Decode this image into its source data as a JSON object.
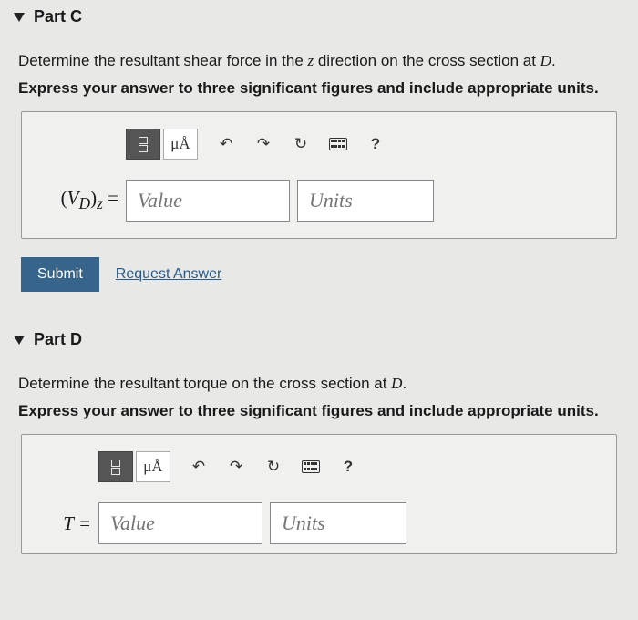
{
  "partC": {
    "title": "Part C",
    "question_pre": "Determine the resultant shear force in the ",
    "question_var": "z",
    "question_mid": " direction on the cross section at ",
    "question_loc": "D",
    "question_post": ".",
    "instruction": "Express your answer to three significant figures and include appropriate units.",
    "var_label_html": "(V_D)_z =",
    "value_placeholder": "Value",
    "units_placeholder": "Units",
    "submit": "Submit",
    "request": "Request Answer"
  },
  "partD": {
    "title": "Part D",
    "question_pre": "Determine the resultant torque on the cross section at ",
    "question_loc": "D",
    "question_post": ".",
    "instruction": "Express your answer to three significant figures and include appropriate units.",
    "var_label": "T =",
    "value_placeholder": "Value",
    "units_placeholder": "Units"
  },
  "toolbar": {
    "mu_a": "μÅ",
    "help": "?"
  }
}
